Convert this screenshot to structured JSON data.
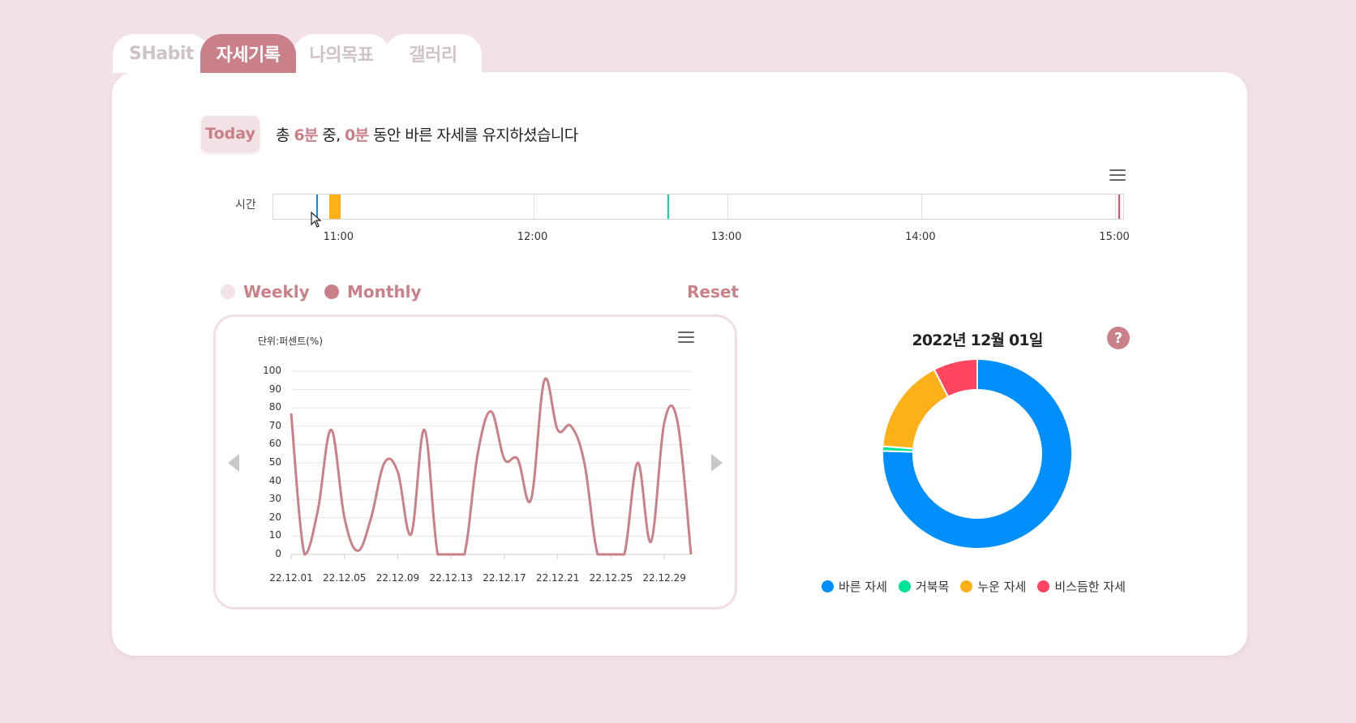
{
  "tabs": [
    {
      "label": "SHabit",
      "active": false
    },
    {
      "label": "자세기록",
      "active": true
    },
    {
      "label": "나의목표",
      "active": false
    },
    {
      "label": "갤러리",
      "active": false
    }
  ],
  "today_button": "Today",
  "summary": {
    "prefix": "총 ",
    "total": "6분",
    "mid": " 중, ",
    "correct": "0분",
    "suffix": " 동안 바른 자세를 유지하셨습니다"
  },
  "timeline": {
    "row_label": "시간",
    "ticks": [
      "11:00",
      "12:00",
      "13:00",
      "14:00",
      "15:00"
    ],
    "start_hour": 10.66,
    "end_hour": 15.05,
    "segments": [
      {
        "start": "10:53",
        "end": "10:53.5",
        "color": "#008ffb"
      },
      {
        "start": "10:57",
        "end": "11:00.5",
        "color": "#feb019"
      },
      {
        "start": "12:41.5",
        "end": "12:42",
        "color": "#00e396"
      },
      {
        "start": "15:01",
        "end": "15:01.4",
        "color": "#ff4560"
      }
    ]
  },
  "period": {
    "weekly": "Weekly",
    "monthly": "Monthly",
    "reset": "Reset",
    "selected": "monthly"
  },
  "chart_data": [
    {
      "type": "line",
      "title": "",
      "subtitle": "단위:퍼센트(%)",
      "xlabel": "",
      "ylabel": "",
      "ylim": [
        0,
        100
      ],
      "yticks": [
        100,
        90,
        80,
        70,
        60,
        50,
        40,
        30,
        20,
        10,
        0
      ],
      "xtick_labels": [
        "22.12.01",
        "22.12.05",
        "22.12.09",
        "22.12.13",
        "22.12.17",
        "22.12.21",
        "22.12.25",
        "22.12.29"
      ],
      "x": [
        "22.12.01",
        "22.12.02",
        "22.12.03",
        "22.12.04",
        "22.12.05",
        "22.12.06",
        "22.12.07",
        "22.12.08",
        "22.12.09",
        "22.12.10",
        "22.12.11",
        "22.12.12",
        "22.12.13",
        "22.12.14",
        "22.12.15",
        "22.12.16",
        "22.12.17",
        "22.12.18",
        "22.12.19",
        "22.12.20",
        "22.12.21",
        "22.12.22",
        "22.12.23",
        "22.12.24",
        "22.12.25",
        "22.12.26",
        "22.12.27",
        "22.12.28",
        "22.12.29",
        "22.12.30",
        "22.12.31"
      ],
      "series": [
        {
          "color": "#c98088",
          "values": [
            77,
            0,
            24,
            68,
            20,
            2,
            20,
            50,
            45,
            11,
            68,
            0,
            0,
            0,
            55,
            78,
            52,
            52,
            30,
            95,
            68,
            70,
            50,
            0,
            0,
            0,
            50,
            7,
            72,
            72,
            0
          ]
        }
      ],
      "grid": true,
      "legend": "none"
    },
    {
      "type": "pie",
      "title": "2022년 12월 01일",
      "donut": true,
      "categories": [
        "바른 자세",
        "거북목",
        "누운 자세",
        "비스듬한 자세"
      ],
      "values": [
        75.5,
        0.8,
        16.2,
        7.5
      ],
      "colors": [
        "#008ffb",
        "#00e396",
        "#feb019",
        "#ff4560"
      ],
      "legend": "bottom"
    }
  ]
}
